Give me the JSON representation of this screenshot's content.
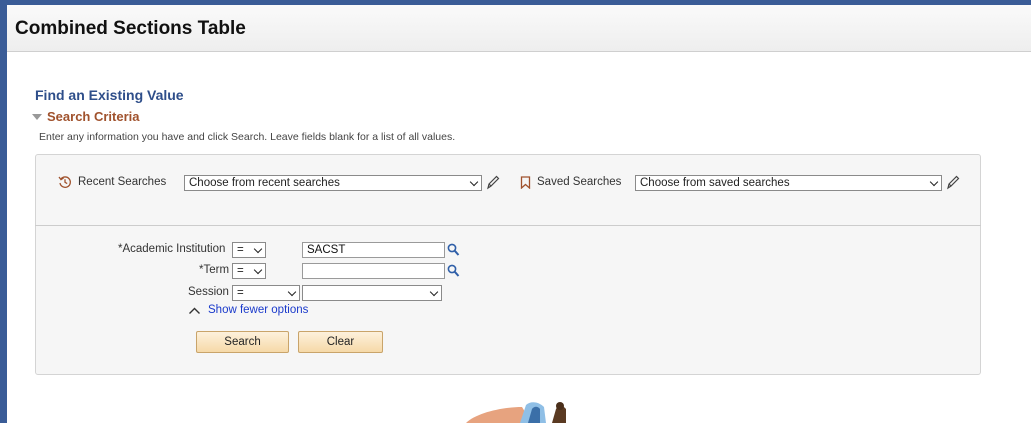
{
  "page": {
    "title": "Combined Sections Table"
  },
  "find": {
    "title": "Find an Existing Value",
    "criteria_label": "Search Criteria",
    "instructions": "Enter any information you have and click Search. Leave fields blank for a list of all values."
  },
  "recent": {
    "label": "Recent Searches",
    "value": "Choose from recent searches"
  },
  "saved": {
    "label": "Saved Searches",
    "value": "Choose from saved searches"
  },
  "fields": {
    "institution": {
      "label": "*Academic Institution",
      "operator": "=",
      "value": "SACST"
    },
    "term": {
      "label": "*Term",
      "operator": "=",
      "value": ""
    },
    "session": {
      "label": "Session",
      "operator": "=",
      "value": ""
    }
  },
  "options_link": "Show fewer options",
  "buttons": {
    "search": "Search",
    "clear": "Clear"
  },
  "colors": {
    "frame": "#3a5c97",
    "heading": "#2e4e8a",
    "criteria": "#a0522d",
    "link": "#1a3acb",
    "button": "#f6d9a8"
  },
  "icons": [
    "history-icon",
    "edit-pencil-icon",
    "bookmark-icon",
    "lookup-magnifier-icon",
    "chevron-up-icon",
    "chevron-down-icon"
  ]
}
